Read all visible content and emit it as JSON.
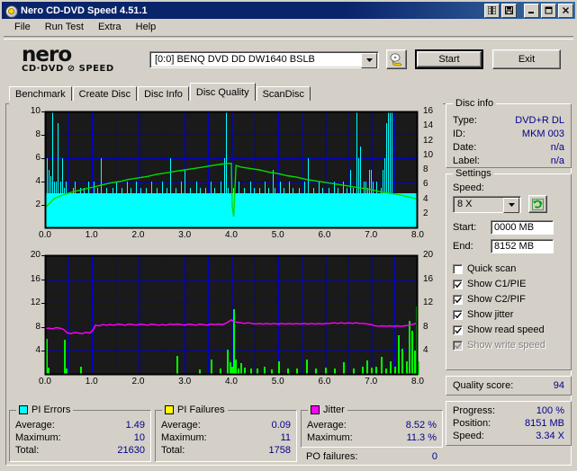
{
  "window": {
    "title": "Nero CD-DVD Speed 4.51.1",
    "icon": "nero-disc-icon",
    "minimize_label": "_",
    "maximize_label": "□",
    "close_label": "✕",
    "extra_buttons": [
      "book-icon",
      "save-icon"
    ]
  },
  "menu": {
    "items": [
      "File",
      "Run Test",
      "Extra",
      "Help"
    ]
  },
  "brand": {
    "line1": "nero",
    "line2": "CD·DVD ⊘ SPEED"
  },
  "drive": {
    "selected": "[0:0]   BENQ DVD DD DW1640 BSLB",
    "dropdown_icon": "chevron-down-icon",
    "eject_icon": "eject-disc-icon"
  },
  "actions": {
    "start": "Start",
    "exit": "Exit"
  },
  "tabs": {
    "items": [
      "Benchmark",
      "Create Disc",
      "Disc Info",
      "Disc Quality",
      "ScanDisc"
    ],
    "active": "Disc Quality"
  },
  "disc_info": {
    "title": "Disc info",
    "rows": [
      {
        "key": "Type:",
        "value": "DVD+R DL"
      },
      {
        "key": "ID:",
        "value": "MKM 003"
      },
      {
        "key": "Date:",
        "value": "n/a"
      },
      {
        "key": "Label:",
        "value": "n/a"
      }
    ]
  },
  "settings": {
    "title": "Settings",
    "speed_label": "Speed:",
    "speed_value": "8 X",
    "refresh_icon": "refresh-icon",
    "start_label": "Start:",
    "start_value": "0000 MB",
    "end_label": "End:",
    "end_value": "8152 MB",
    "checkboxes": [
      {
        "label": "Quick scan",
        "checked": false,
        "enabled": true
      },
      {
        "label": "Show C1/PIE",
        "checked": true,
        "enabled": true
      },
      {
        "label": "Show C2/PIF",
        "checked": true,
        "enabled": true
      },
      {
        "label": "Show jitter",
        "checked": true,
        "enabled": true
      },
      {
        "label": "Show read speed",
        "checked": true,
        "enabled": true
      },
      {
        "label": "Show write speed",
        "checked": true,
        "enabled": false
      }
    ]
  },
  "quality": {
    "label": "Quality score:",
    "value": "94"
  },
  "status": {
    "rows": [
      {
        "key": "Progress:",
        "value": "100 %"
      },
      {
        "key": "Position:",
        "value": "8151 MB"
      },
      {
        "key": "Speed:",
        "value": "3.34 X"
      }
    ]
  },
  "stats": {
    "pi_errors": {
      "title": "PI Errors",
      "color": "#00ffff",
      "rows": [
        {
          "key": "Average:",
          "value": "1.49"
        },
        {
          "key": "Maximum:",
          "value": "10"
        },
        {
          "key": "Total:",
          "value": "21630"
        }
      ]
    },
    "pi_failures": {
      "title": "PI Failures",
      "color": "#ffff00",
      "rows": [
        {
          "key": "Average:",
          "value": "0.09"
        },
        {
          "key": "Maximum:",
          "value": "11"
        },
        {
          "key": "Total:",
          "value": "1758"
        }
      ]
    },
    "jitter": {
      "title": "Jitter",
      "color": "#ff00ff",
      "rows": [
        {
          "key": "Average:",
          "value": "8.52 %"
        },
        {
          "key": "Maximum:",
          "value": "11.3 %"
        }
      ],
      "po_label": "PO failures:",
      "po_value": "0"
    }
  },
  "chart_data": [
    {
      "type": "bar",
      "name": "pi-errors-chart",
      "title": "",
      "xlabel": "",
      "ylabel": "PI Errors",
      "xtick_labels": [
        "0.0",
        "1.0",
        "2.0",
        "3.0",
        "4.0",
        "5.0",
        "6.0",
        "7.0",
        "8.0"
      ],
      "xlim": [
        0,
        8
      ],
      "ylim": [
        0,
        10
      ],
      "ytick_labels": [
        "2",
        "4",
        "6",
        "8",
        "10"
      ],
      "ylim_right": [
        0,
        16
      ],
      "ytick_labels_right": [
        "2",
        "4",
        "6",
        "8",
        "10",
        "12",
        "14",
        "16"
      ],
      "grid": true,
      "plot_bg": "#1a1a1a",
      "grid_color": "#0000cc",
      "series": [
        {
          "name": "PI Errors",
          "color": "#00ffff",
          "axis": "left",
          "kind": "bar",
          "x": [
            0.0,
            0.04,
            0.08,
            0.12,
            0.16,
            0.2,
            0.24,
            0.28,
            0.32,
            0.36,
            0.4,
            0.44,
            0.48,
            0.52,
            0.56,
            0.6,
            0.64,
            0.68,
            0.72,
            0.76,
            0.8,
            0.84,
            0.88,
            0.92,
            0.96,
            1.0,
            1.04,
            1.08,
            1.12,
            1.16,
            1.2,
            1.24,
            1.28,
            1.32,
            1.36,
            1.4,
            1.44,
            1.48,
            1.52,
            1.56,
            1.6,
            1.64,
            1.68,
            1.72,
            1.76,
            1.8,
            1.84,
            1.88,
            1.92,
            1.96,
            2.0,
            2.04,
            2.08,
            2.12,
            2.16,
            2.2,
            2.24,
            2.28,
            2.32,
            2.36,
            2.4,
            2.44,
            2.48,
            2.52,
            2.56,
            2.6,
            2.64,
            2.68,
            2.72,
            2.76,
            2.8,
            2.84,
            2.88,
            2.92,
            2.96,
            3.0,
            3.04,
            3.08,
            3.12,
            3.16,
            3.2,
            3.24,
            3.28,
            3.32,
            3.36,
            3.4,
            3.44,
            3.48,
            3.52,
            3.56,
            3.6,
            3.64,
            3.68,
            3.72,
            3.76,
            3.8,
            3.84,
            3.88,
            3.92,
            3.96,
            4.0,
            4.04,
            4.08,
            4.12,
            4.16,
            4.2,
            4.24,
            4.28,
            4.32,
            4.36,
            4.4,
            4.44,
            4.48,
            4.52,
            4.56,
            4.6,
            4.64,
            4.68,
            4.72,
            4.76,
            4.8,
            4.84,
            4.88,
            4.92,
            4.96,
            5.0,
            5.04,
            5.08,
            5.12,
            5.16,
            5.2,
            5.24,
            5.28,
            5.32,
            5.36,
            5.4,
            5.44,
            5.48,
            5.52,
            5.56,
            5.6,
            5.64,
            5.68,
            5.72,
            5.76,
            5.8,
            5.84,
            5.88,
            5.92,
            5.96,
            6.0,
            6.04,
            6.08,
            6.12,
            6.16,
            6.2,
            6.24,
            6.28,
            6.32,
            6.36,
            6.4,
            6.44,
            6.48,
            6.52,
            6.56,
            6.6,
            6.64,
            6.68,
            6.72,
            6.76,
            6.8,
            6.84,
            6.88,
            6.92,
            6.96,
            7.0,
            7.04,
            7.08,
            7.12,
            7.16,
            7.2,
            7.24,
            7.28,
            7.32,
            7.36,
            7.4,
            7.44,
            7.48,
            7.52,
            7.56,
            7.6,
            7.64,
            7.68,
            7.72,
            7.76,
            7.8,
            7.84,
            7.88,
            7.92,
            7.96,
            8.0
          ],
          "values": [
            10,
            6,
            5,
            4.5,
            10,
            4,
            4,
            9,
            4,
            6,
            3.5,
            4,
            3,
            3,
            2,
            3.5,
            4,
            3,
            3,
            3.5,
            3,
            3.5,
            3,
            4,
            3,
            3,
            4,
            3,
            3.5,
            3,
            6,
            3,
            3,
            3.5,
            3,
            3,
            3.5,
            3,
            4,
            3,
            2,
            3.5,
            3,
            3,
            4,
            3,
            3.5,
            3,
            3,
            4,
            3,
            3.5,
            3,
            2,
            3.5,
            3,
            3,
            4,
            3,
            3,
            3.5,
            3,
            3,
            4,
            3,
            3.5,
            3,
            6,
            3,
            3,
            3.5,
            3,
            3,
            4,
            3,
            5,
            3,
            3,
            3.5,
            3,
            3,
            4,
            3,
            3.5,
            3,
            2,
            3.5,
            3,
            3,
            4,
            3,
            3.5,
            3,
            3,
            4,
            3,
            6,
            10,
            3.5,
            3,
            2,
            3.5,
            3,
            3,
            4,
            3,
            3,
            3.5,
            3,
            3,
            4,
            3,
            3.5,
            3,
            3,
            3.5,
            3,
            3,
            4,
            3,
            3.5,
            3,
            5,
            3.5,
            3,
            3,
            4,
            3,
            3.5,
            3,
            3,
            4,
            3,
            3.5,
            3,
            2,
            3.5,
            3,
            3,
            4,
            3,
            6,
            3,
            3,
            3.5,
            3,
            3,
            4,
            3,
            3.5,
            3,
            3,
            3.5,
            3,
            3,
            4,
            3,
            3.5,
            3,
            3,
            4,
            3,
            3.5,
            3,
            5,
            3.5,
            3,
            10,
            6,
            7,
            3,
            4,
            4,
            3.5,
            5,
            5,
            4,
            3,
            4,
            3,
            3.5,
            5,
            6,
            9,
            14,
            16,
            13
          ]
        },
        {
          "name": "Read speed",
          "color": "#00dd00",
          "axis": "right",
          "kind": "line",
          "x": [
            0.0,
            0.2,
            0.4,
            0.6,
            0.8,
            1.0,
            1.2,
            1.4,
            1.6,
            1.8,
            2.0,
            2.2,
            2.4,
            2.6,
            2.8,
            3.0,
            3.2,
            3.4,
            3.6,
            3.8,
            4.0,
            4.02,
            4.05,
            4.1,
            4.2,
            4.4,
            4.6,
            4.8,
            5.0,
            5.2,
            5.4,
            5.6,
            5.8,
            6.0,
            6.2,
            6.4,
            6.6,
            6.8,
            7.0,
            7.2,
            7.4,
            7.6,
            7.8,
            8.0
          ],
          "values": [
            2.8,
            4.1,
            4.6,
            5.0,
            5.3,
            5.6,
            5.9,
            6.2,
            6.4,
            6.7,
            6.9,
            7.1,
            7.4,
            7.6,
            7.8,
            8.0,
            8.2,
            8.4,
            8.6,
            8.8,
            8.9,
            3.0,
            1.6,
            8.6,
            8.4,
            8.2,
            8.0,
            7.7,
            7.5,
            7.2,
            7.0,
            6.7,
            6.5,
            6.3,
            6.1,
            5.9,
            5.7,
            5.5,
            5.3,
            5.0,
            4.8,
            4.6,
            4.3,
            4.0
          ]
        }
      ]
    },
    {
      "type": "bar",
      "name": "jitter-pif-chart",
      "title": "",
      "xlabel": "",
      "ylabel": "Jitter %",
      "xtick_labels": [
        "0.0",
        "1.0",
        "2.0",
        "3.0",
        "4.0",
        "5.0",
        "6.0",
        "7.0",
        "8.0"
      ],
      "xlim": [
        0,
        8
      ],
      "ylim": [
        0,
        20
      ],
      "ytick_labels": [
        "4",
        "8",
        "12",
        "16",
        "20"
      ],
      "ylim_right": [
        0,
        20
      ],
      "ytick_labels_right": [
        "4",
        "8",
        "12",
        "16",
        "20"
      ],
      "grid": true,
      "plot_bg": "#1a1a1a",
      "grid_color": "#0000cc",
      "series": [
        {
          "name": "PI Failures",
          "color": "#00ff00",
          "axis": "left",
          "kind": "bar",
          "x": [
            0.02,
            0.05,
            0.4,
            0.44,
            0.75,
            2.82,
            3.3,
            3.55,
            3.75,
            3.9,
            3.96,
            4.0,
            4.04,
            4.08,
            4.14,
            4.2,
            4.28,
            4.4,
            4.55,
            4.7,
            4.85,
            5.0,
            5.2,
            5.4,
            5.6,
            5.8,
            6.0,
            6.2,
            6.4,
            6.6,
            6.8,
            6.9,
            7.0,
            7.1,
            7.2,
            7.3,
            7.4,
            7.5,
            7.58,
            7.66,
            7.74,
            7.8,
            7.86,
            7.92,
            7.96,
            8.0
          ],
          "values": [
            6,
            1.2,
            5.8,
            1.1,
            1.3,
            3.2,
            0.9,
            2.5,
            1.1,
            4.2,
            2.1,
            1.3,
            11,
            2.6,
            1.1,
            2.0,
            1.2,
            1.0,
            1.1,
            1.3,
            0.9,
            2.2,
            1.0,
            1.1,
            2.6,
            1.0,
            1.2,
            1.0,
            2.1,
            1.1,
            1.4,
            2.4,
            1.2,
            1.3,
            3.0,
            1.1,
            2.2,
            1.3,
            6.6,
            4.4,
            2.2,
            9.0,
            7.4,
            4.0,
            11.5,
            2.2
          ]
        },
        {
          "name": "Jitter",
          "color": "#ff00ff",
          "axis": "left",
          "kind": "line",
          "x": [
            0.0,
            0.08,
            0.16,
            0.24,
            0.32,
            0.4,
            0.48,
            0.56,
            0.64,
            0.72,
            0.8,
            0.88,
            0.96,
            1.04,
            1.08,
            1.16,
            1.24,
            1.32,
            1.4,
            1.48,
            1.56,
            1.64,
            1.72,
            1.8,
            1.88,
            1.96,
            2.04,
            2.12,
            2.2,
            2.28,
            2.36,
            2.44,
            2.52,
            2.6,
            2.68,
            2.76,
            2.84,
            2.92,
            3.0,
            3.08,
            3.16,
            3.24,
            3.32,
            3.4,
            3.48,
            3.56,
            3.64,
            3.72,
            3.8,
            3.88,
            3.96,
            4.0,
            4.04,
            4.12,
            4.2,
            4.28,
            4.36,
            4.44,
            4.52,
            4.6,
            4.68,
            4.76,
            4.84,
            4.92,
            5.0,
            5.08,
            5.16,
            5.24,
            5.32,
            5.4,
            5.48,
            5.56,
            5.64,
            5.72,
            5.8,
            5.88,
            5.96,
            6.04,
            6.12,
            6.2,
            6.28,
            6.36,
            6.44,
            6.52,
            6.6,
            6.68,
            6.76,
            6.84,
            6.92,
            7.0,
            7.08,
            7.16,
            7.24,
            7.32,
            7.4,
            7.48,
            7.56,
            7.64,
            7.72,
            7.8,
            7.88,
            7.96,
            8.0
          ],
          "values": [
            7.7,
            7.8,
            7.7,
            7.9,
            7.8,
            7.6,
            7.0,
            6.9,
            7.1,
            7.0,
            6.9,
            7.1,
            7.0,
            7.6,
            8.3,
            8.2,
            8.4,
            8.3,
            8.4,
            8.3,
            8.5,
            8.4,
            8.3,
            8.5,
            8.4,
            8.3,
            8.5,
            8.4,
            8.3,
            8.5,
            8.4,
            8.3,
            8.4,
            8.3,
            8.5,
            8.4,
            8.5,
            8.4,
            8.3,
            8.5,
            8.4,
            8.3,
            8.5,
            8.4,
            8.3,
            8.5,
            8.4,
            8.5,
            8.4,
            8.6,
            9.0,
            9.2,
            9.0,
            8.8,
            8.7,
            8.6,
            8.7,
            8.6,
            8.5,
            8.6,
            8.5,
            8.6,
            8.5,
            8.6,
            8.5,
            8.6,
            8.5,
            8.6,
            8.5,
            8.6,
            8.5,
            8.6,
            8.5,
            8.6,
            8.5,
            8.6,
            8.5,
            8.6,
            8.6,
            8.7,
            8.6,
            8.7,
            8.6,
            8.7,
            8.6,
            8.7,
            8.6,
            8.6,
            8.5,
            8.4,
            8.2,
            8.1,
            8.2,
            8.1,
            8.2,
            8.1,
            8.2,
            8.1,
            8.2,
            8.3,
            8.4,
            8.6,
            8.8
          ]
        }
      ]
    }
  ]
}
